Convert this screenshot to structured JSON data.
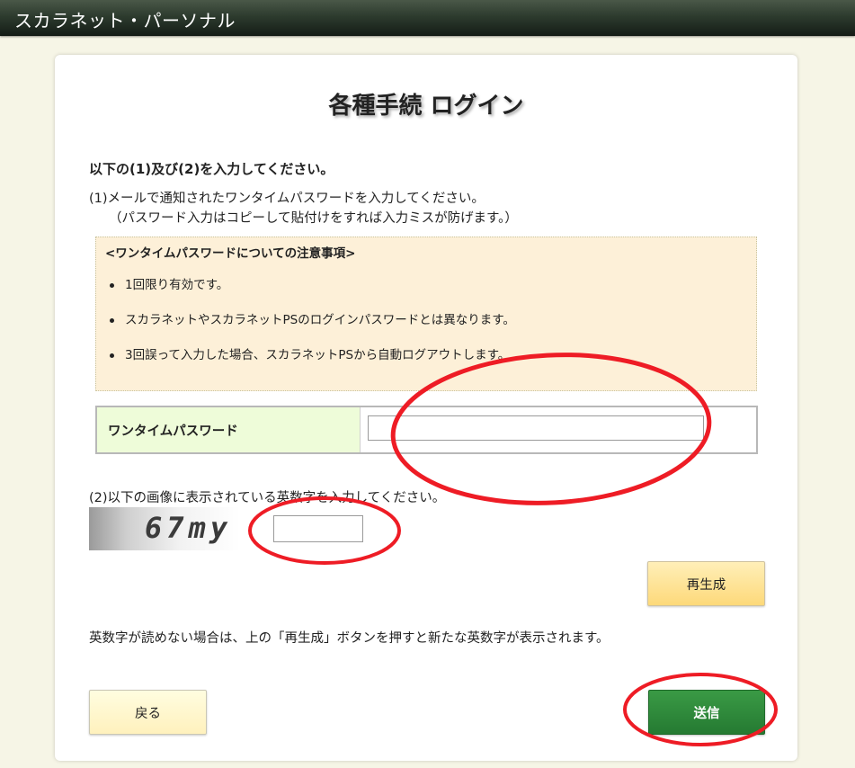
{
  "header": {
    "app_title": "スカラネット・パーソナル"
  },
  "page": {
    "title": "各種手続 ログイン",
    "instruction": "以下の(1)及び(2)を入力してください。",
    "step1_text": "(1)メールで通知されたワンタイムパスワードを入力してください。",
    "step1_note": "（パスワード入力はコピーして貼付けをすれば入力ミスが防げます。）",
    "notice": {
      "title": "<ワンタイムパスワードについての注意事項>",
      "items": [
        "1回限り有効です。",
        "スカラネットやスカラネットPSのログインパスワードとは異なります。",
        "3回誤って入力した場合、スカラネットPSから自動ログアウトします。"
      ]
    },
    "otp": {
      "label": "ワンタイムパスワード",
      "value": ""
    },
    "step2_text": "(2)以下の画像に表示されている英数字を入力してください。",
    "captcha": {
      "image_text": "67my",
      "value": ""
    },
    "help_text": "英数字が読めない場合は、上の「再生成」ボタンを押すと新たな英数字が表示されます。"
  },
  "buttons": {
    "regenerate": "再生成",
    "back": "戻る",
    "submit": "送信"
  },
  "colors": {
    "header_bg": "#2d3b2e",
    "page_bg": "#f6f5e6",
    "notice_bg": "#fdf0d8",
    "otp_label_bg": "#eefcd9",
    "submit_bg": "#2e8b3c",
    "annotation": "#ee1c25"
  }
}
